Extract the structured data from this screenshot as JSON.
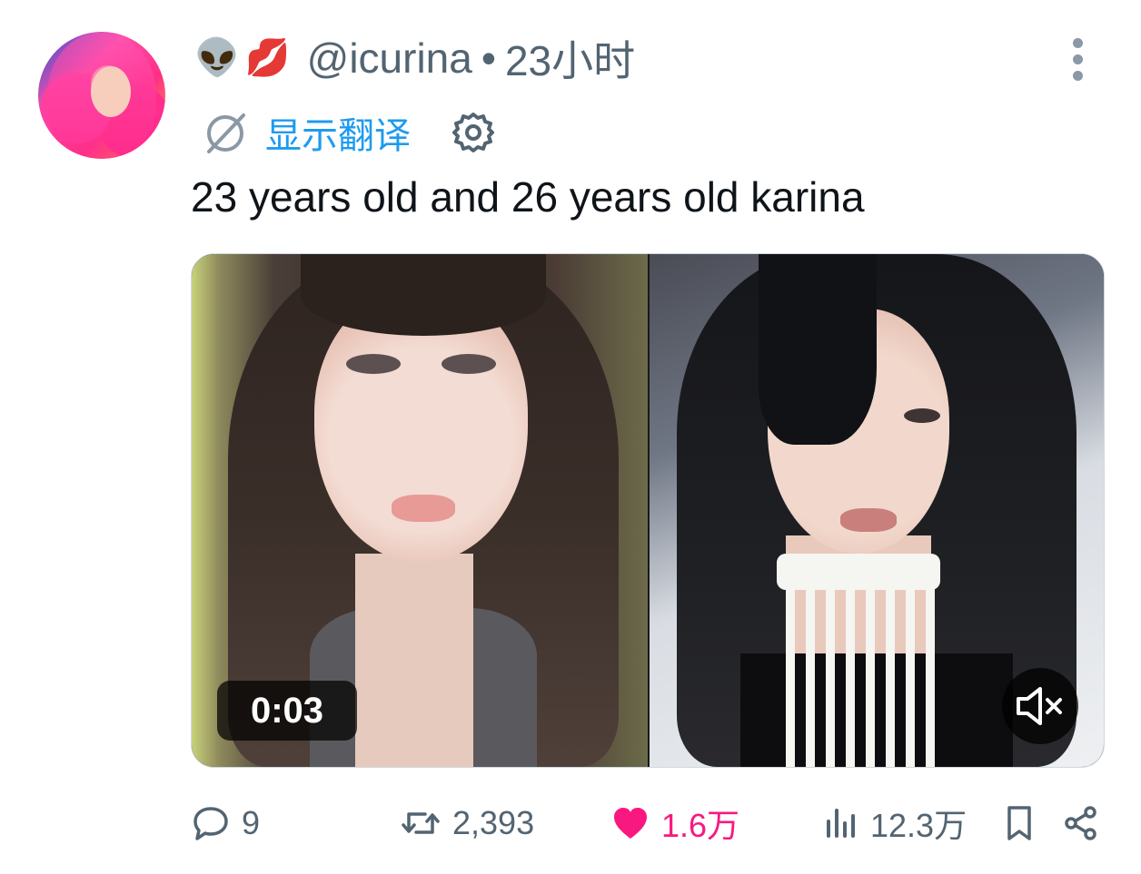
{
  "tweet": {
    "author_emojis": [
      "👽",
      "💋"
    ],
    "handle": "@icurina",
    "separator": "•",
    "time": "23小时",
    "translate_label": "显示翻译",
    "text": "23 years old and 26 years old karina"
  },
  "media": {
    "duration": "0:03",
    "muted": true
  },
  "actions": {
    "replies": "9",
    "retweets": "2,393",
    "likes": "1.6万",
    "views": "12.3万"
  },
  "colors": {
    "accent": "#1d9bf0",
    "secondary_text": "#536471",
    "like": "#f91880",
    "text": "#0f1419"
  },
  "icons": [
    "more-icon",
    "translate-icon",
    "gear-icon",
    "mute-icon",
    "reply-icon",
    "retweet-icon",
    "heart-icon",
    "views-icon",
    "bookmark-icon",
    "share-icon"
  ]
}
